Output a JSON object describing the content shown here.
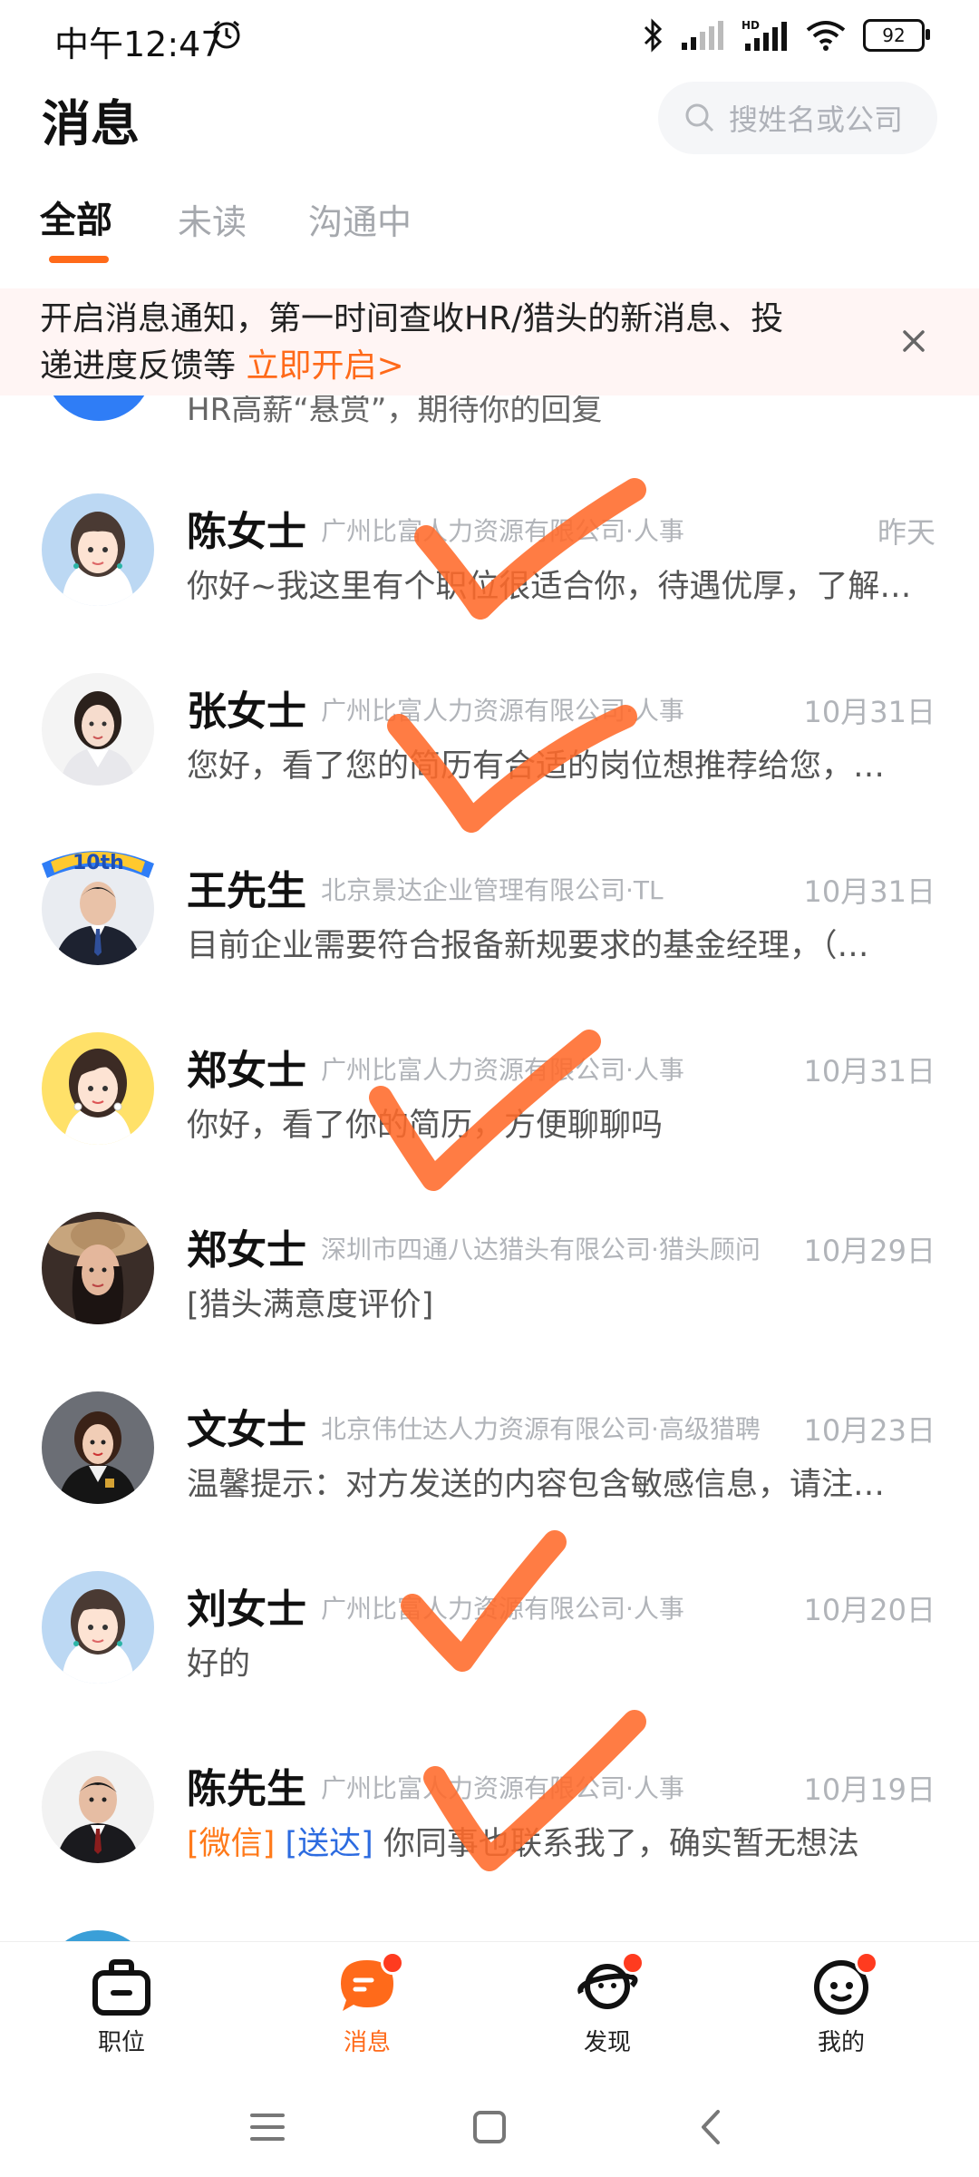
{
  "status_bar": {
    "time": "中午12:47",
    "battery": "92"
  },
  "header": {
    "title": "消息",
    "search_placeholder": "搜姓名或公司"
  },
  "tabs": [
    {
      "label": "全部",
      "active": true
    },
    {
      "label": "未读",
      "active": false
    },
    {
      "label": "沟通中",
      "active": false
    }
  ],
  "banner": {
    "text_line1": "开启消息通知，第一时间查收HR/猎头的新消息、投",
    "text_line2": "递进度反馈等 ",
    "link": "立即开启>"
  },
  "partial_row": {
    "message": "HR高薪“悬赏”，期待你的回复"
  },
  "conversations": [
    {
      "name": "陈女士",
      "company": "广州比富人力资源有限公司·人事",
      "date": "昨天",
      "message": "你好~我这里有个职位很适合你，待遇优厚，了解…"
    },
    {
      "name": "张女士",
      "company": "广州比富人力资源有限公司·人事",
      "date": "10月31日",
      "message": "您好，看了您的简历有合适的岗位想推荐给您，…"
    },
    {
      "name": "王先生",
      "company": "北京景达企业管理有限公司·TL",
      "date": "10月31日",
      "message": "目前企业需要符合报备新规要求的基金经理，（…",
      "badge": "10th"
    },
    {
      "name": "郑女士",
      "company": "广州比富人力资源有限公司·人事",
      "date": "10月31日",
      "message": "你好，看了你的简历，方便聊聊吗"
    },
    {
      "name": "郑女士",
      "company": "深圳市四通八达猎头有限公司·猎头顾问",
      "date": "10月29日",
      "message": "[猎头满意度评价]"
    },
    {
      "name": "文女士",
      "company": "北京伟仕达人力资源有限公司·高级猎聘",
      "date": "10月23日",
      "message": "温馨提示：对方发送的内容包含敏感信息，请注…"
    },
    {
      "name": "刘女士",
      "company": "广州比富人力资源有限公司·人事",
      "date": "10月20日",
      "message": "好的"
    },
    {
      "name": "陈先生",
      "company": "广州比富人力资源有限公司·人事",
      "date": "10月19日",
      "tag1": "[微信]",
      "tag2": "[送达]",
      "message": "你同事也联系我了，确实暂无想法"
    }
  ],
  "tabbar": [
    {
      "label": "职位",
      "icon": "briefcase-icon"
    },
    {
      "label": "消息",
      "icon": "message-icon",
      "active": true
    },
    {
      "label": "发现",
      "icon": "planet-icon"
    },
    {
      "label": "我的",
      "icon": "smile-face-icon"
    }
  ],
  "colors": {
    "accent": "#ff6a1a",
    "blue_tag": "#2c6be0",
    "banner_bg": "#fff5f4"
  }
}
